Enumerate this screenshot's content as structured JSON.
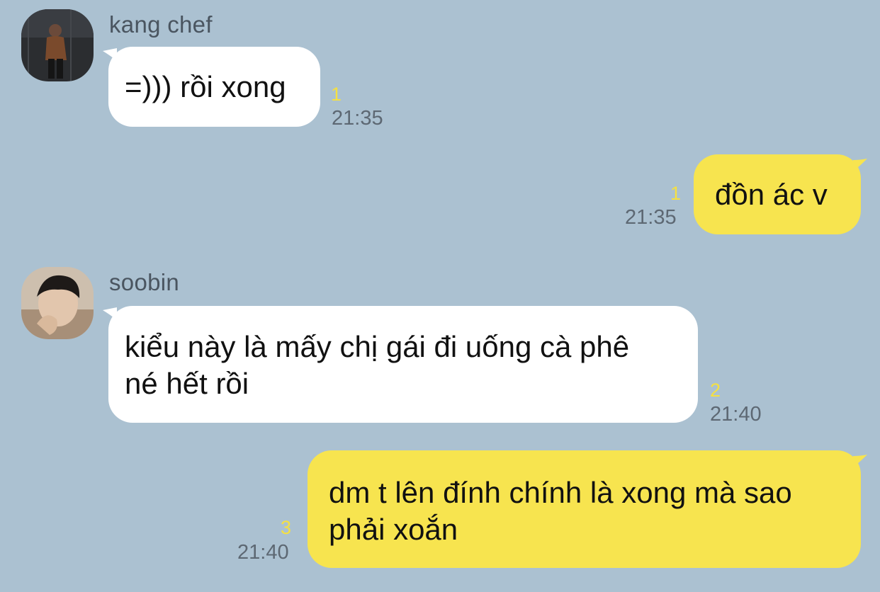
{
  "messages": [
    {
      "direction": "incoming",
      "sender": "kang chef",
      "avatar": "profile-photo-dark",
      "text": "=))) rồi xong",
      "unread": "1",
      "time": "21:35"
    },
    {
      "direction": "outgoing",
      "text": "đồn ác v",
      "unread": "1",
      "time": "21:35"
    },
    {
      "direction": "incoming",
      "sender": "soobin",
      "avatar": "profile-photo-face",
      "text_lines": [
        "kiểu này là mấy chị gái đi uống cà phê",
        "né hết rồi"
      ],
      "unread": "2",
      "time": "21:40"
    },
    {
      "direction": "outgoing",
      "text_lines": [
        "dm t lên đính chính là xong mà sao",
        "phải xoắn"
      ],
      "unread": "3",
      "time": "21:40"
    }
  ],
  "colors": {
    "background": "#abc1d1",
    "incoming_bubble": "#ffffff",
    "outgoing_bubble": "#f7e44f",
    "unread_count": "#f5e042",
    "timestamp": "#5d6873"
  }
}
